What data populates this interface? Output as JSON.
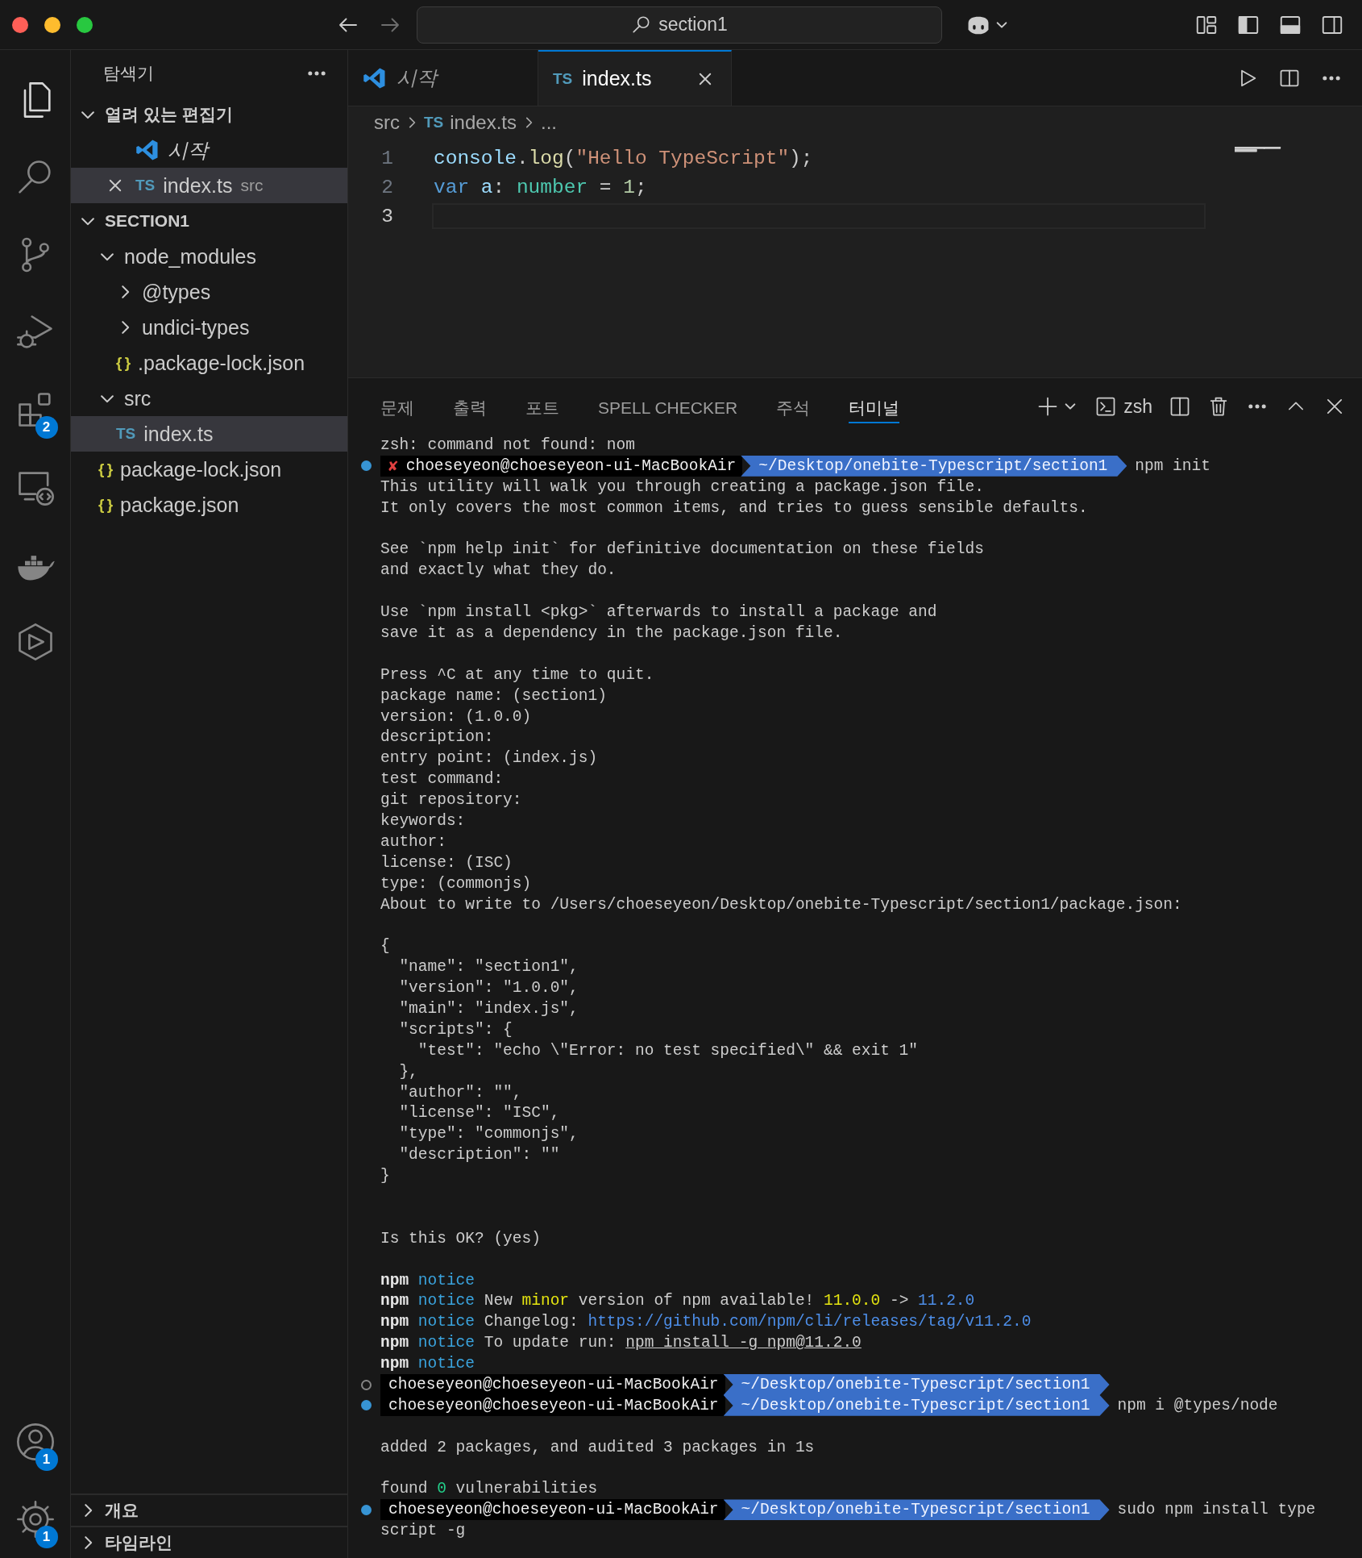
{
  "title_bar": {
    "search": "section1"
  },
  "activity_bar": {
    "top": [
      {
        "selected": true
      },
      {
        "selected": false
      },
      {
        "selected": false
      },
      {
        "selected": false
      },
      {
        "selected": false,
        "badge": "2"
      },
      {
        "selected": false
      },
      {
        "selected": false
      },
      {
        "selected": false
      }
    ],
    "bottom": [
      {
        "selected": false,
        "badge": "1"
      },
      {
        "selected": false,
        "badge": "1"
      }
    ]
  },
  "sidebar": {
    "title": "탐색기",
    "sections": [
      {
        "title": "열려 있는 편집기",
        "expanded": true,
        "items": [
          {
            "kind": "welcome",
            "label": "시작",
            "selected": false,
            "close": false
          },
          {
            "kind": "ts",
            "icon_text": "TS",
            "label": "index.ts",
            "description": "src",
            "selected": true,
            "close": true
          }
        ]
      },
      {
        "title": "SECTION1",
        "expanded": true,
        "items": [
          {
            "kind": "folder",
            "label": "node_modules",
            "expanded": true,
            "selected": false,
            "children": [
              {
                "kind": "folder",
                "label": "@types",
                "expanded": false,
                "selected": false
              },
              {
                "kind": "folder",
                "label": "undici-types",
                "expanded": false,
                "selected": false
              },
              {
                "kind": "json",
                "icon_text": "{ }",
                "label": ".package-lock.json",
                "selected": false
              }
            ]
          },
          {
            "kind": "folder",
            "label": "src",
            "expanded": true,
            "selected": false,
            "children": [
              {
                "kind": "ts",
                "icon_text": "TS",
                "label": "index.ts",
                "selected": true
              }
            ]
          },
          {
            "kind": "json",
            "icon_text": "{ }",
            "label": "package-lock.json",
            "selected": false
          },
          {
            "kind": "json",
            "icon_text": "{ }",
            "label": "package.json",
            "selected": false
          }
        ]
      }
    ],
    "bottom_sections": [
      {
        "title": "개요",
        "expanded": false
      },
      {
        "title": "타임라인",
        "expanded": false
      }
    ]
  },
  "editor": {
    "tabs": [
      {
        "kind": "welcome",
        "label": "시작",
        "selected": false,
        "close": false
      },
      {
        "kind": "ts",
        "icon_text": "TS",
        "label": "index.ts",
        "selected": true,
        "close": true
      }
    ],
    "breadcrumb": [
      {
        "label": "src"
      },
      {
        "label": "index.ts",
        "icon_text": "TS"
      },
      {
        "label": "..."
      }
    ],
    "lines": [
      {
        "number": "1",
        "active": false,
        "tokens": [
          {
            "text": "console",
            "kind": "variable"
          },
          {
            "text": ".",
            "kind": "plain"
          },
          {
            "text": "log",
            "kind": "function"
          },
          {
            "text": "(",
            "kind": "plain"
          },
          {
            "text": "\"Hello TypeScript\"",
            "kind": "string"
          },
          {
            "text": ");",
            "kind": "plain"
          }
        ]
      },
      {
        "number": "2",
        "active": false,
        "tokens": [
          {
            "text": "var",
            "kind": "keyword"
          },
          {
            "text": " a",
            "kind": "variable"
          },
          {
            "text": ": ",
            "kind": "plain"
          },
          {
            "text": "number",
            "kind": "type"
          },
          {
            "text": " = ",
            "kind": "plain"
          },
          {
            "text": "1",
            "kind": "number"
          },
          {
            "text": ";",
            "kind": "plain"
          }
        ]
      },
      {
        "number": "3",
        "active": true
      }
    ]
  },
  "panel": {
    "tabs": [
      {
        "label": "문제",
        "selected": false
      },
      {
        "label": "출력",
        "selected": false
      },
      {
        "label": "포트",
        "selected": false
      },
      {
        "label": "SPELL CHECKER",
        "selected": false
      },
      {
        "label": "주석",
        "selected": false
      },
      {
        "label": "터미널",
        "selected": true
      }
    ],
    "terminal_name": "zsh",
    "terminal": [
      {
        "kind": "text",
        "text": "zsh: command not found: nom"
      },
      {
        "kind": "prompt",
        "filled": true,
        "error_mark": "✘",
        "user": "choeseyeon@choeseyeon-ui-MacBookAir",
        "path": "~/Desktop/onebite-Typescript/section1",
        "command": "npm init"
      },
      {
        "kind": "text",
        "text": "This utility will walk you through creating a package.json file."
      },
      {
        "kind": "text",
        "text": "It only covers the most common items, and tries to guess sensible defaults."
      },
      {
        "kind": "blank"
      },
      {
        "kind": "text",
        "text": "See `npm help init` for definitive documentation on these fields"
      },
      {
        "kind": "text",
        "text": "and exactly what they do."
      },
      {
        "kind": "blank"
      },
      {
        "kind": "text",
        "text": "Use `npm install <pkg>` afterwards to install a package and"
      },
      {
        "kind": "text",
        "text": "save it as a dependency in the package.json file."
      },
      {
        "kind": "blank"
      },
      {
        "kind": "text",
        "text": "Press ^C at any time to quit."
      },
      {
        "kind": "text",
        "text": "package name: (section1)"
      },
      {
        "kind": "text",
        "text": "version: (1.0.0)"
      },
      {
        "kind": "text",
        "text": "description:"
      },
      {
        "kind": "text",
        "text": "entry point: (index.js)"
      },
      {
        "kind": "text",
        "text": "test command:"
      },
      {
        "kind": "text",
        "text": "git repository:"
      },
      {
        "kind": "text",
        "text": "keywords:"
      },
      {
        "kind": "text",
        "text": "author:"
      },
      {
        "kind": "text",
        "text": "license: (ISC)"
      },
      {
        "kind": "text",
        "text": "type: (commonjs)"
      },
      {
        "kind": "text",
        "text": "About to write to /Users/choeseyeon/Desktop/onebite-Typescript/section1/package.json:"
      },
      {
        "kind": "blank"
      },
      {
        "kind": "text",
        "text": "{"
      },
      {
        "kind": "text",
        "text": "  \"name\": \"section1\","
      },
      {
        "kind": "text",
        "text": "  \"version\": \"1.0.0\","
      },
      {
        "kind": "text",
        "text": "  \"main\": \"index.js\","
      },
      {
        "kind": "text",
        "text": "  \"scripts\": {"
      },
      {
        "kind": "text",
        "text": "    \"test\": \"echo \\\"Error: no test specified\\\" && exit 1\""
      },
      {
        "kind": "text",
        "text": "  },"
      },
      {
        "kind": "text",
        "text": "  \"author\": \"\","
      },
      {
        "kind": "text",
        "text": "  \"license\": \"ISC\","
      },
      {
        "kind": "text",
        "text": "  \"type\": \"commonjs\","
      },
      {
        "kind": "text",
        "text": "  \"description\": \"\""
      },
      {
        "kind": "text",
        "text": "}"
      },
      {
        "kind": "blank"
      },
      {
        "kind": "blank"
      },
      {
        "kind": "text",
        "text": "Is this OK? (yes)"
      },
      {
        "kind": "blank"
      },
      {
        "kind": "styled",
        "segments": [
          {
            "text": "npm",
            "kind": "bold"
          },
          {
            "text": " notice",
            "kind": "notice"
          }
        ]
      },
      {
        "kind": "styled",
        "segments": [
          {
            "text": "npm",
            "kind": "bold"
          },
          {
            "text": " notice",
            "kind": "notice"
          },
          {
            "text": " New ",
            "kind": "plain"
          },
          {
            "text": "minor",
            "kind": "highlight"
          },
          {
            "text": " version of npm available! ",
            "kind": "plain"
          },
          {
            "text": "11.0.0",
            "kind": "highlight"
          },
          {
            "text": " -> ",
            "kind": "plain"
          },
          {
            "text": "11.2.0",
            "kind": "link"
          }
        ]
      },
      {
        "kind": "styled",
        "segments": [
          {
            "text": "npm",
            "kind": "bold"
          },
          {
            "text": " notice",
            "kind": "notice"
          },
          {
            "text": " Changelog: ",
            "kind": "plain"
          },
          {
            "text": "https://github.com/npm/cli/releases/tag/v11.2.0",
            "kind": "link"
          }
        ]
      },
      {
        "kind": "styled",
        "segments": [
          {
            "text": "npm",
            "kind": "bold"
          },
          {
            "text": " notice",
            "kind": "notice"
          },
          {
            "text": " To update run: ",
            "kind": "plain"
          },
          {
            "text": "npm install -g npm@11.2.0",
            "kind": "underline"
          }
        ]
      },
      {
        "kind": "styled",
        "segments": [
          {
            "text": "npm",
            "kind": "bold"
          },
          {
            "text": " notice",
            "kind": "notice"
          }
        ]
      },
      {
        "kind": "prompt",
        "filled": false,
        "user": "choeseyeon@choeseyeon-ui-MacBookAir",
        "path": "~/Desktop/onebite-Typescript/section1"
      },
      {
        "kind": "prompt",
        "filled": true,
        "user": "choeseyeon@choeseyeon-ui-MacBookAir",
        "path": "~/Desktop/onebite-Typescript/section1",
        "command": "npm i @types/node"
      },
      {
        "kind": "blank"
      },
      {
        "kind": "text",
        "text": "added 2 packages, and audited 3 packages in 1s"
      },
      {
        "kind": "blank"
      },
      {
        "kind": "styled",
        "segments": [
          {
            "text": "found ",
            "kind": "plain"
          },
          {
            "text": "0",
            "kind": "success"
          },
          {
            "text": " vulnerabilities",
            "kind": "plain"
          }
        ]
      },
      {
        "kind": "prompt",
        "filled": true,
        "user": "choeseyeon@choeseyeon-ui-MacBookAir",
        "path": "~/Desktop/onebite-Typescript/section1",
        "command": "sudo npm install type"
      },
      {
        "kind": "text",
        "text": "script -g"
      }
    ]
  }
}
